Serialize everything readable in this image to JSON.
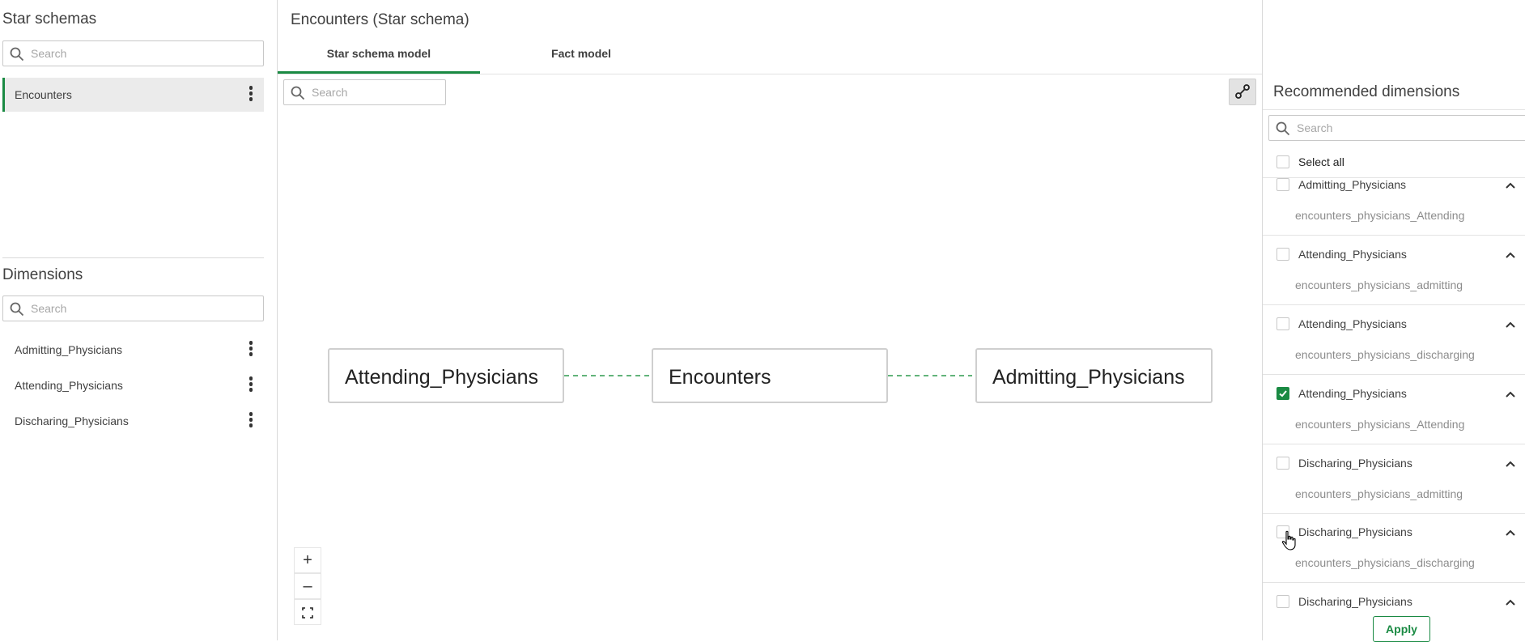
{
  "left": {
    "schemas_title": "Star schemas",
    "schemas_search_placeholder": "Search",
    "schemas": [
      {
        "label": "Encounters",
        "selected": true
      }
    ],
    "dimensions_title": "Dimensions",
    "dimensions_search_placeholder": "Search",
    "dimensions": [
      {
        "label": "Admitting_Physicians"
      },
      {
        "label": "Attending_Physicians"
      },
      {
        "label": "Discharing_Physicians"
      }
    ]
  },
  "center": {
    "page_title": "Encounters (Star schema)",
    "tabs": [
      {
        "label": "Star schema model",
        "active": true
      },
      {
        "label": "Fact model",
        "active": false
      }
    ],
    "canvas_search_placeholder": "Search",
    "nodes": {
      "left": "Attending_Physicians",
      "center": "Encounters",
      "right": "Admitting_Physicians"
    },
    "zoom": {
      "in_icon": "+",
      "out_icon": "–",
      "fit_icon": "fit-screen-icon"
    }
  },
  "right": {
    "title": "Recommended dimensions",
    "search_placeholder": "Search",
    "select_all_label": "Select all",
    "items": [
      {
        "name": "Admitting_Physicians",
        "sub": "encounters_physicians_Attending",
        "checked": false
      },
      {
        "name": "Attending_Physicians",
        "sub": "encounters_physicians_admitting",
        "checked": false
      },
      {
        "name": "Attending_Physicians",
        "sub": "encounters_physicians_discharging",
        "checked": false
      },
      {
        "name": "Attending_Physicians",
        "sub": "encounters_physicians_Attending",
        "checked": true
      },
      {
        "name": "Discharing_Physicians",
        "sub": "encounters_physicians_admitting",
        "checked": false
      },
      {
        "name": "Discharing_Physicians",
        "sub": "encounters_physicians_discharging",
        "checked": false
      },
      {
        "name": "Discharing_Physicians",
        "sub": "",
        "checked": false
      }
    ],
    "apply_label": "Apply"
  },
  "colors": {
    "accent": "#1a8a43",
    "edge": "#2e9a4e",
    "border": "#d9d9d9"
  }
}
